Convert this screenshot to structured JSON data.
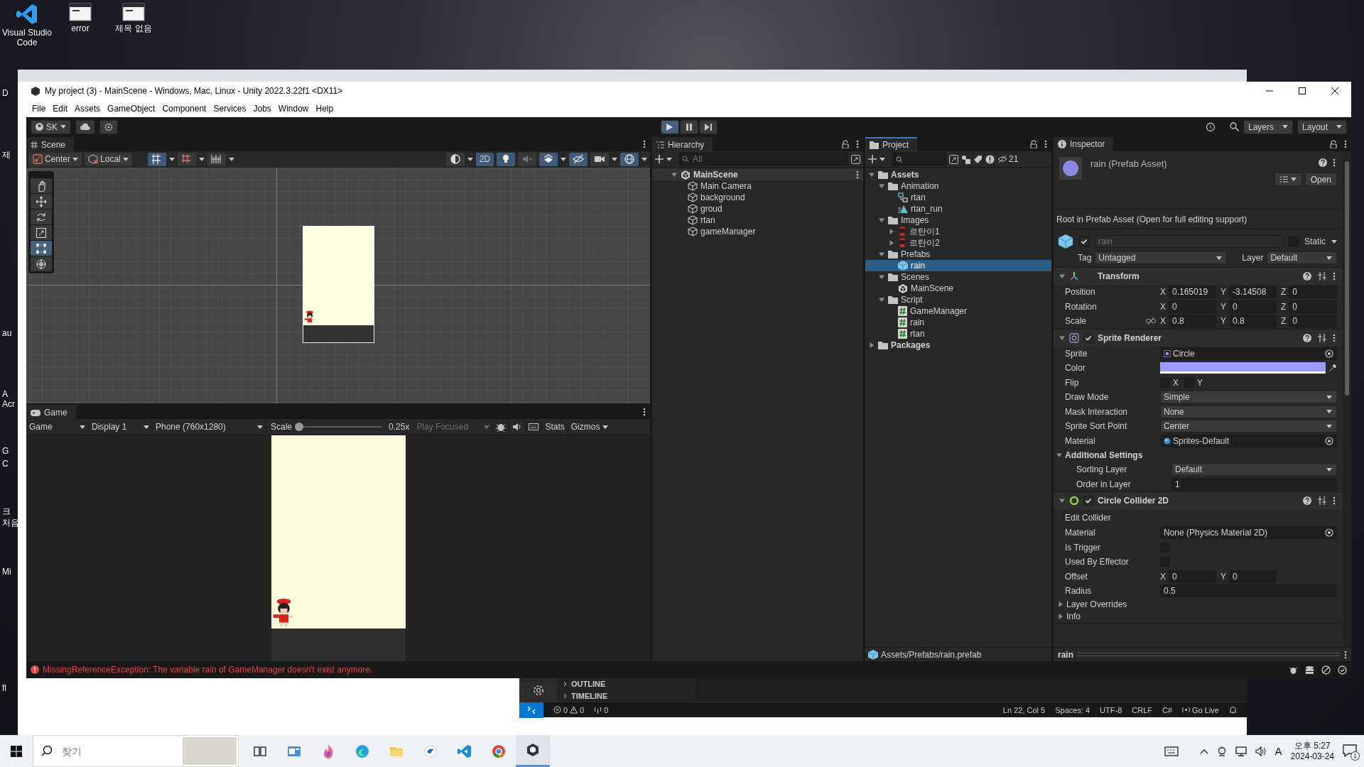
{
  "desktop": {
    "icons": [
      {
        "label": "Visual Studio Code",
        "kind": "vscode"
      },
      {
        "label": "error",
        "kind": "window"
      },
      {
        "label": "제목 없음",
        "kind": "window"
      }
    ],
    "edge_labels": [
      "D",
      "제",
      "au",
      "A",
      "Acr",
      "G",
      "C",
      "크",
      "처음",
      "Mi",
      "fl"
    ]
  },
  "unity": {
    "title": "My project (3) - MainScene - Windows, Mac, Linux - Unity 2022.3.22f1 <DX11>",
    "menu": [
      "File",
      "Edit",
      "Assets",
      "GameObject",
      "Component",
      "Services",
      "Jobs",
      "Window",
      "Help"
    ],
    "toolbar": {
      "account": "SK",
      "playing": true,
      "paused": false,
      "layers": "Layers",
      "layout": "Layout"
    },
    "scene": {
      "tab": "Scene",
      "pivot": "Center",
      "space": "Local",
      "left_toggles": [
        {
          "kind": "grid",
          "on": true
        },
        {
          "kind": "snap",
          "on": false
        },
        {
          "kind": "increment",
          "on": false
        }
      ],
      "right_toggles": [
        {
          "kind": "shading",
          "on": false
        },
        {
          "kind": "dimension",
          "label": "2D",
          "on": true
        },
        {
          "kind": "light",
          "on": true
        },
        {
          "kind": "audio",
          "on": false
        },
        {
          "kind": "fx",
          "on": true
        },
        {
          "kind": "visibility",
          "on": true
        },
        {
          "kind": "camera",
          "on": false
        },
        {
          "kind": "gizmos",
          "on": true
        }
      ],
      "tools": [
        {
          "kind": "hand",
          "selected": false
        },
        {
          "kind": "move",
          "selected": false
        },
        {
          "kind": "rotate",
          "selected": false
        },
        {
          "kind": "scale",
          "selected": false
        },
        {
          "kind": "rect",
          "selected": true
        },
        {
          "kind": "transform",
          "selected": false
        }
      ]
    },
    "game": {
      "tab": "Game",
      "view": "Game",
      "display": "Display 1",
      "resolution": "Phone (760x1280)",
      "scale_label": "Scale",
      "scale": {
        "level": 0
      },
      "scale_value": "0.25x",
      "play_focused": "Play Focused",
      "stats": "Stats",
      "gizmos": "Gizmos"
    },
    "hierarchy": {
      "tab": "Hierarchy",
      "placeholder": "All",
      "scene": {
        "name": "MainScene",
        "expanded": true,
        "children": [
          {
            "name": "Main Camera"
          },
          {
            "name": "background"
          },
          {
            "name": "groud"
          },
          {
            "name": "rtan"
          },
          {
            "name": "gameManager"
          }
        ]
      }
    },
    "project": {
      "tab": "Project",
      "hidden_count": "21",
      "path": "Assets/Prefabs/rain.prefab",
      "tree": [
        {
          "name": "Assets",
          "kind": "folder",
          "expanded": true,
          "selected": false,
          "children": [
            {
              "name": "Animation",
              "kind": "folder",
              "expanded": true,
              "selected": false,
              "children": [
                {
                  "name": "rtan",
                  "kind": "animator",
                  "selected": false
                },
                {
                  "name": "rtan_run",
                  "kind": "clip",
                  "selected": false
                }
              ]
            },
            {
              "name": "Images",
              "kind": "folder",
              "expanded": true,
              "selected": false,
              "children": [
                {
                  "name": "르탄이1",
                  "kind": "sprite",
                  "expanded": false,
                  "selected": false
                },
                {
                  "name": "르탄이2",
                  "kind": "sprite",
                  "expanded": false,
                  "selected": false
                }
              ]
            },
            {
              "name": "Prefabs",
              "kind": "folder",
              "expanded": true,
              "selected": false,
              "children": [
                {
                  "name": "rain",
                  "kind": "prefab",
                  "selected": true
                }
              ]
            },
            {
              "name": "Scenes",
              "kind": "folder",
              "expanded": true,
              "selected": false,
              "children": [
                {
                  "name": "MainScene",
                  "kind": "scene",
                  "selected": false
                }
              ]
            },
            {
              "name": "Script",
              "kind": "folder",
              "expanded": true,
              "selected": false,
              "children": [
                {
                  "name": "GameManager",
                  "kind": "script",
                  "selected": false
                },
                {
                  "name": "rain",
                  "kind": "script",
                  "selected": false
                },
                {
                  "name": "rtan",
                  "kind": "script",
                  "selected": false
                }
              ]
            }
          ]
        },
        {
          "name": "Packages",
          "kind": "folder",
          "expanded": false,
          "selected": false
        }
      ]
    },
    "inspector": {
      "tab": "Inspector",
      "title": "rain (Prefab Asset)",
      "open": "Open",
      "note": "Root in Prefab Asset (Open for full editing support)",
      "active": true,
      "name": "rain",
      "static_label": "Static",
      "static": false,
      "tag_label": "Tag",
      "tag": "Untagged",
      "layer_label": "Layer",
      "layer": "Default",
      "components": [
        {
          "kind": "transform",
          "title": "Transform",
          "expanded": true,
          "rows": [
            {
              "kind": "vector",
              "label": "Position",
              "fields": [
                {
                  "axis": "X",
                  "value": "0.165019"
                },
                {
                  "axis": "Y",
                  "value": "-3.14508"
                },
                {
                  "axis": "Z",
                  "value": "0"
                }
              ]
            },
            {
              "kind": "vector",
              "label": "Rotation",
              "fields": [
                {
                  "axis": "X",
                  "value": "0"
                },
                {
                  "axis": "Y",
                  "value": "0"
                },
                {
                  "axis": "Z",
                  "value": "0"
                }
              ]
            },
            {
              "kind": "vector",
              "label": "Scale",
              "proportions_linked": false,
              "fields": [
                {
                  "axis": "X",
                  "value": "0.8"
                },
                {
                  "axis": "Y",
                  "value": "0.8"
                },
                {
                  "axis": "Z",
                  "value": "0"
                }
              ]
            }
          ]
        },
        {
          "kind": "sprite_renderer",
          "title": "Sprite Renderer",
          "expanded": true,
          "enabled": true,
          "rows": [
            {
              "kind": "object",
              "label": "Sprite",
              "value": "Circle",
              "asset": {
                "kind": "sprite"
              }
            },
            {
              "kind": "color",
              "label": "Color",
              "color": "#9b9bfb"
            },
            {
              "kind": "toggles",
              "label": "Flip",
              "fields": [
                {
                  "axis": "X",
                  "checked": false
                },
                {
                  "axis": "Y",
                  "checked": false
                }
              ]
            },
            {
              "kind": "dropdown",
              "label": "Draw Mode",
              "value": "Simple"
            },
            {
              "kind": "dropdown",
              "label": "Mask Interaction",
              "value": "None"
            },
            {
              "kind": "dropdown",
              "label": "Sprite Sort Point",
              "value": "Center"
            },
            {
              "kind": "object",
              "label": "Material",
              "value": "Sprites-Default",
              "asset": {
                "kind": "material"
              }
            },
            {
              "kind": "section",
              "label": "Additional Settings",
              "expanded": true,
              "rows": [
                {
                  "kind": "dropdown",
                  "label": "Sorting Layer",
                  "value": "Default"
                },
                {
                  "kind": "number",
                  "label": "Order in Layer",
                  "value": "1"
                }
              ]
            }
          ]
        },
        {
          "kind": "circle_collider",
          "title": "Circle Collider 2D",
          "expanded": true,
          "enabled": true,
          "rows": [
            {
              "kind": "label",
              "label": "Edit Collider"
            },
            {
              "kind": "object",
              "label": "Material",
              "value": "None (Physics Material 2D)"
            },
            {
              "kind": "checkbox",
              "label": "Is Trigger",
              "checked": false
            },
            {
              "kind": "checkbox",
              "label": "Used By Effector",
              "checked": false
            },
            {
              "kind": "vector",
              "label": "Offset",
              "fields": [
                {
                  "axis": "X",
                  "value": "0"
                },
                {
                  "axis": "Y",
                  "value": "0"
                }
              ]
            },
            {
              "kind": "number",
              "label": "Radius",
              "value": "0.5"
            },
            {
              "kind": "section",
              "label": "Layer Overrides",
              "expanded": false
            },
            {
              "kind": "section",
              "label": "Info",
              "expanded": false
            }
          ]
        }
      ],
      "preview": "rain"
    },
    "console": {
      "message": "MissingReferenceException: The variable rain of GameManager doesn't exist anymore."
    }
  },
  "vscode": {
    "sections": [
      {
        "label": "OUTLINE",
        "expanded": false
      },
      {
        "label": "TIMELINE",
        "expanded": false
      }
    ],
    "errors": "0",
    "warnings": "0",
    "ports": "0",
    "status_items": [
      "Ln 22, Col 5",
      "Spaces: 4",
      "UTF-8",
      "CRLF",
      "C#"
    ],
    "go_live": "Go Live"
  },
  "taskbar": {
    "search_placeholder": "찾기",
    "apps": [
      {
        "kind": "taskview",
        "active": false
      },
      {
        "kind": "news",
        "active": false
      },
      {
        "kind": "flame",
        "active": false
      },
      {
        "kind": "wave",
        "active": false
      },
      {
        "kind": "folder",
        "active": false
      },
      {
        "kind": "bird",
        "active": false
      },
      {
        "kind": "ribbon",
        "active": false
      },
      {
        "kind": "ring",
        "active": false
      },
      {
        "kind": "cube",
        "active": true
      }
    ],
    "ime": "A",
    "time": "오후 5:27",
    "date": "2024-03-24",
    "notifications": "1"
  }
}
